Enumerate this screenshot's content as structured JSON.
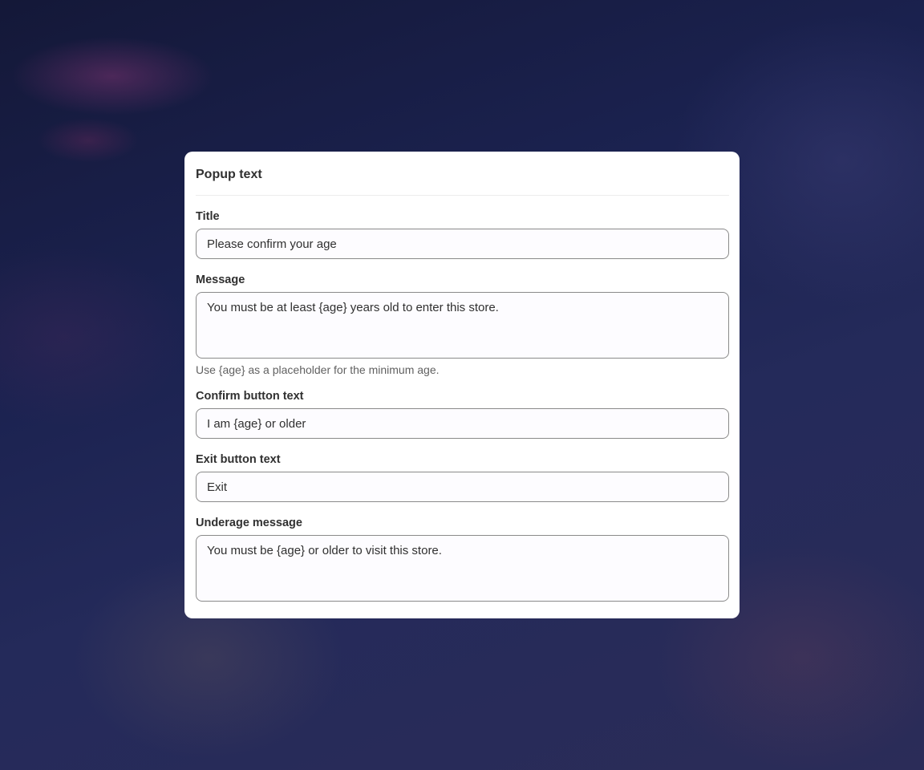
{
  "card": {
    "title": "Popup text"
  },
  "fields": {
    "title": {
      "label": "Title",
      "value": "Please confirm your age"
    },
    "message": {
      "label": "Message",
      "value": "You must be at least {age} years old to enter this store.",
      "help": "Use {age} as a placeholder for the minimum age."
    },
    "confirm_button_text": {
      "label": "Confirm button text",
      "value": "I am {age} or older"
    },
    "exit_button_text": {
      "label": "Exit button text",
      "value": "Exit"
    },
    "underage_message": {
      "label": "Underage message",
      "value": "You must be {age} or older to visit this store."
    }
  }
}
